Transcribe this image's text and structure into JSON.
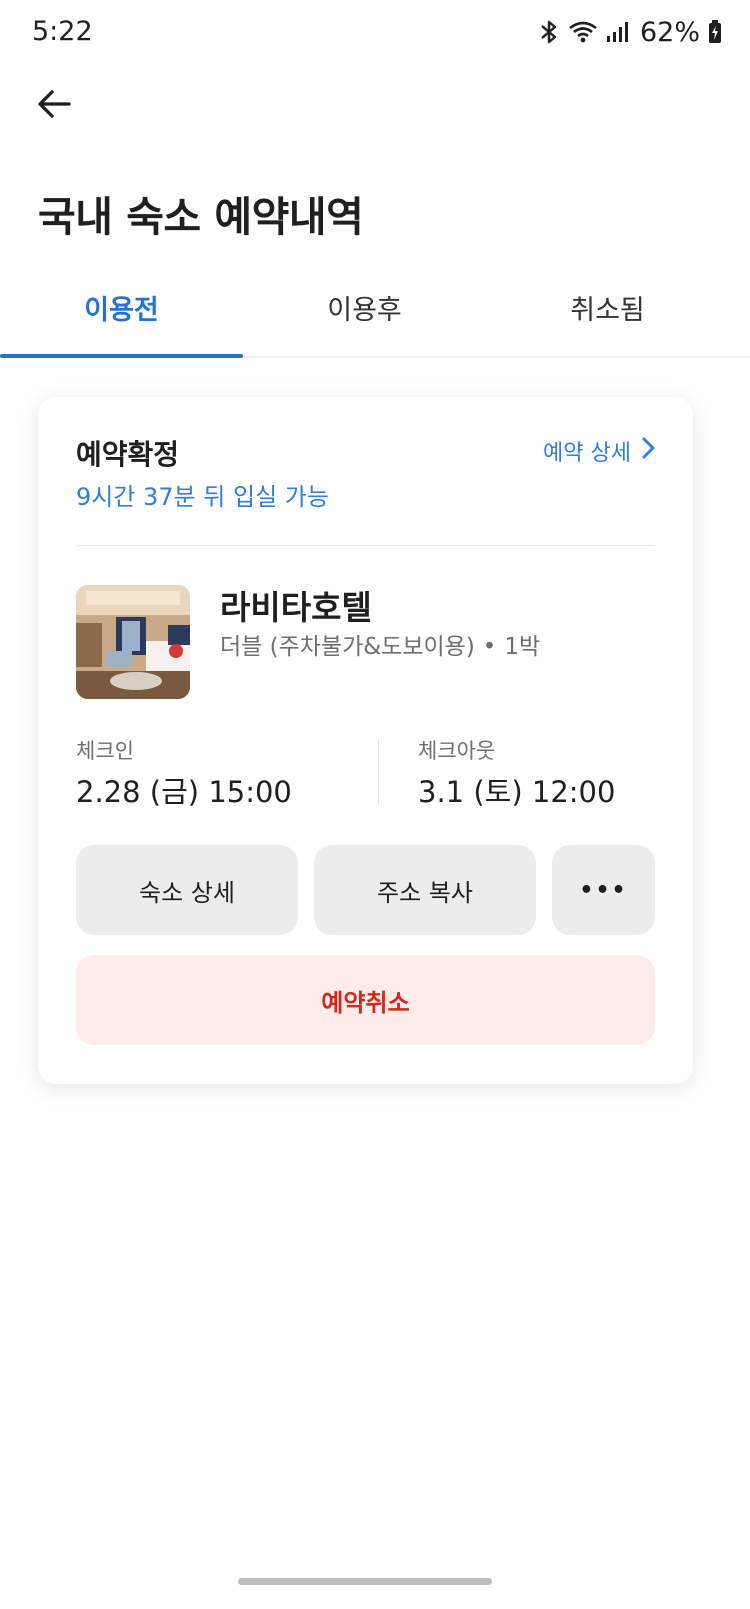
{
  "status_bar": {
    "time": "5:22",
    "battery_pct": "62%",
    "icons": [
      "bluetooth-icon",
      "wifi-icon",
      "signal-icon",
      "battery-icon"
    ]
  },
  "header": {
    "back_icon": "arrow-left-icon",
    "title": "국내 숙소 예약내역"
  },
  "tabs": [
    {
      "label": "이용전",
      "active": true
    },
    {
      "label": "이용후",
      "active": false
    },
    {
      "label": "취소됨",
      "active": false
    }
  ],
  "reservation": {
    "status": "예약확정",
    "checkin_hint": "9시간 37분 뒤 입실 가능",
    "detail_link": "예약 상세",
    "hotel_name": "라비타호텔",
    "room_type": "더블 (주차불가&도보이용)",
    "separator": "•",
    "nights": "1박",
    "checkin": {
      "label": "체크인",
      "value": "2.28 (금) 15:00"
    },
    "checkout": {
      "label": "체크아웃",
      "value": "3.1 (토) 12:00"
    },
    "buttons": {
      "hotel_detail": "숙소 상세",
      "copy_address": "주소 복사",
      "more": "•••"
    },
    "cancel_label": "예약취소"
  },
  "colors": {
    "accent": "#2473d2",
    "link": "#2e7fe0",
    "cancel_text": "#d3281f",
    "cancel_bg": "#fdecea",
    "button_bg": "#ececec"
  }
}
